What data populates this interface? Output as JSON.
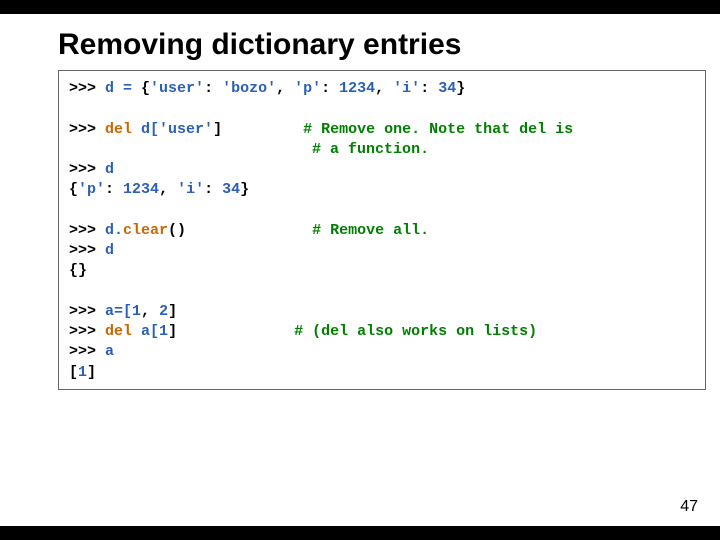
{
  "title": "Removing dictionary entries",
  "page_number": "47",
  "code": {
    "l1_p": ">>> ",
    "l1_d": "d = ",
    "l1_b1": "{",
    "l1_s1": "'user'",
    "l1_c1": ": ",
    "l1_s2": "'bozo'",
    "l1_c2": ", ",
    "l1_s3": "'p'",
    "l1_c3": ": ",
    "l1_n1": "1234",
    "l1_c4": ", ",
    "l1_s4": "'i'",
    "l1_c5": ": ",
    "l1_n2": "34",
    "l1_b2": "}",
    "l3_p": ">>> ",
    "l3_k": "del ",
    "l3_d": "d[",
    "l3_s": "'user'",
    "l3_b": "]",
    "l3_pad": "         ",
    "l3_c": "# Remove one. Note that del is",
    "l4_pad": "                           ",
    "l4_c": "# a function.",
    "l5_p": ">>> ",
    "l5_d": "d",
    "l6_b1": "{",
    "l6_s1": "'p'",
    "l6_c1": ": ",
    "l6_n1": "1234",
    "l6_c2": ", ",
    "l6_s2": "'i'",
    "l6_c3": ": ",
    "l6_n2": "34",
    "l6_b2": "}",
    "l8_p": ">>> ",
    "l8_d": "d.",
    "l8_k": "clear",
    "l8_b": "()",
    "l8_pad": "              ",
    "l8_c": "# Remove all.",
    "l9_p": ">>> ",
    "l9_d": "d",
    "l10": "{}",
    "l12_p": ">>> ",
    "l12_d": "a=[",
    "l12_n1": "1",
    "l12_c": ", ",
    "l12_n2": "2",
    "l12_b": "]",
    "l13_p": ">>> ",
    "l13_k": "del ",
    "l13_d": "a[",
    "l13_n": "1",
    "l13_b": "]",
    "l13_pad": "             ",
    "l13_c": "# (del also works on lists)",
    "l14_p": ">>> ",
    "l14_d": "a",
    "l15_b1": "[",
    "l15_n": "1",
    "l15_b2": "]"
  }
}
